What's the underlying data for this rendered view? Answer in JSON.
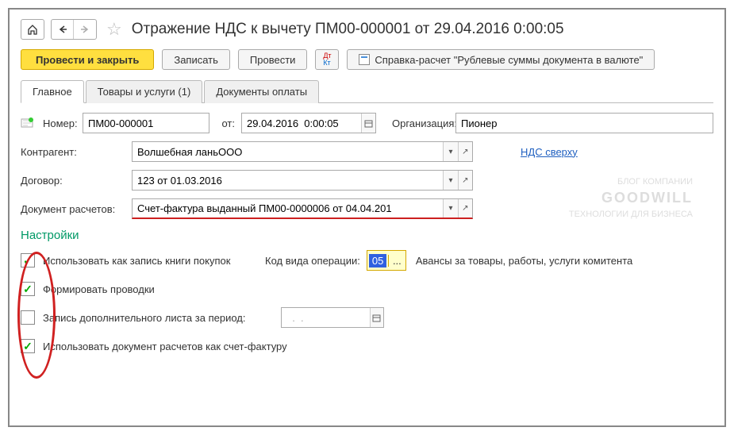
{
  "header": {
    "title": "Отражение НДС к вычету ПМ00-000001 от 29.04.2016 0:00:05"
  },
  "toolbar": {
    "post_close": "Провести и закрыть",
    "save": "Записать",
    "post": "Провести",
    "report": "Справка-расчет \"Рублевые суммы документа в валюте\""
  },
  "tabs": [
    {
      "label": "Главное",
      "active": true
    },
    {
      "label": "Товары и услуги (1)",
      "active": false
    },
    {
      "label": "Документы оплаты",
      "active": false
    }
  ],
  "form": {
    "number_label": "Номер:",
    "number": "ПМ00-000001",
    "date_label": "от:",
    "date": "29.04.2016  0:00:05",
    "org_label": "Организация:",
    "org": "Пионер",
    "counterparty_label": "Контрагент:",
    "counterparty": "Волшебная ланьООО",
    "vat_link": "НДС сверху",
    "contract_label": "Договор:",
    "contract": "123 от 01.03.2016",
    "settlement_doc_label": "Документ расчетов:",
    "settlement_doc": "Счет-фактура выданный ПМ00-0000006 от 04.04.201"
  },
  "settings": {
    "title": "Настройки",
    "use_as_purchase_book": "Использовать как запись книги покупок",
    "op_code_label": "Код вида операции:",
    "op_code": "05",
    "op_code_desc": "Авансы за товары, работы, услуги комитента",
    "form_entries": "Формировать проводки",
    "additional_sheet": "Запись дополнительного листа за период:",
    "additional_date": "  .  .",
    "use_doc_as_invoice": "Использовать документ расчетов как счет-фактуру"
  },
  "watermark": {
    "line1": "БЛОГ КОМПАНИИ",
    "line2": "GOODWILL",
    "line3": "ТЕХНОЛОГИИ ДЛЯ БИЗНЕСА"
  }
}
